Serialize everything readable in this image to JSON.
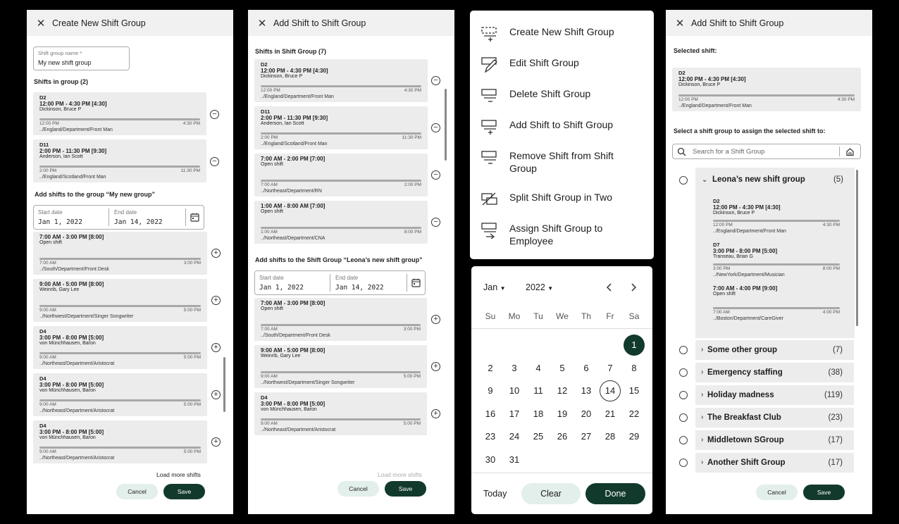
{
  "p1": {
    "title": "Create New Shift Group",
    "name_label": "Shift group name *",
    "name_value": "My new shift group",
    "shifts_heading": "Shifts in group (2)",
    "group_shifts": [
      {
        "tag": "D2",
        "time": "12:00 PM - 4:30 PM [4:30]",
        "name": "Dickinson, Bruce P",
        "start": "12:00 PM",
        "end": "4:30 PM",
        "path": "../England/Department/Front Man"
      },
      {
        "tag": "D11",
        "time": "2:00 PM - 11:30 PM [9:30]",
        "name": "Anderson, Ian Scott",
        "start": "2:00 PM",
        "end": "11:30 PM",
        "path": "../England/Scotland/Front Man"
      }
    ],
    "add_heading": "Add shifts to the group “My new group”",
    "start_label": "Start date",
    "start_value": "Jan 1, 2022",
    "end_label": "End date",
    "end_value": "Jan 14, 2022",
    "available": [
      {
        "tag": "",
        "time": "7:00 AM - 3:00 PM [8:00]",
        "name": "Open shift",
        "start": "7:00 AM",
        "end": "3:00 PM",
        "path": "../South/Department/Front Desk"
      },
      {
        "tag": "",
        "time": "9:00 AM - 5:00 PM [8:00]",
        "name": "Weinrib, Gary Lee",
        "start": "9:00 AM",
        "end": "5:00 PM",
        "path": "../Northwest/Department/Singer Songwriter"
      },
      {
        "tag": "D4",
        "time": "3:00 PM - 8:00 PM [5:00]",
        "name": "von Münchhausen, Baron",
        "start": "9:00 AM",
        "end": "5:00 PM",
        "path": "../Northeast/Department/Aristocrat"
      },
      {
        "tag": "D4",
        "time": "3:00 PM - 8:00 PM [5:00]",
        "name": "von Münchhausen, Baron",
        "start": "9:00 AM",
        "end": "5:00 PM",
        "path": "../Northeast/Department/Aristocrat"
      },
      {
        "tag": "D4",
        "time": "3:00 PM - 8:00 PM [5:00]",
        "name": "von Münchhausen, Baron",
        "start": "9:00 AM",
        "end": "5:00 PM",
        "path": "../Northeast/Department/Aristocrat"
      }
    ],
    "load_more": "Load more shifts",
    "cancel": "Cancel",
    "save": "Save"
  },
  "p2": {
    "title": "Add Shift to Shift Group",
    "shifts_heading": "Shifts in Shift Group (7)",
    "group_shifts": [
      {
        "tag": "D2",
        "time": "12:00 PM - 4:30 PM [4:30]",
        "name": "Dickinson, Bruce P",
        "start": "12:00 PM",
        "end": "4:30 PM",
        "path": "../England/Department/Front Man"
      },
      {
        "tag": "D11",
        "time": "2:00 PM - 11:30 PM [9:30]",
        "name": "Anderson, Ian Scott",
        "start": "2:00 PM",
        "end": "11:30 PM",
        "path": "../England/Scotland/Front Man"
      },
      {
        "tag": "",
        "time": "7:00 AM - 2:00 PM [7:00]",
        "name": "Open shift",
        "start": "7:00 AM",
        "end": "2:00 PM",
        "path": "../Northeast/Department/RN"
      },
      {
        "tag": "",
        "time": "1:00 AM - 8:00 AM [7:00]",
        "name": "Open shift",
        "start": "1:00 AM",
        "end": "8:00 PM",
        "path": "../Northeast/Department/CNA"
      }
    ],
    "add_heading": "Add shifts to the Shift Group “Leona’s new shift group”",
    "start_label": "Start date",
    "start_value": "Jan 1, 2022",
    "end_label": "End date",
    "end_value": "Jan 14, 2022",
    "available": [
      {
        "tag": "",
        "time": "7:00 AM - 3:00 PM [8:00]",
        "name": "Open shift",
        "start": "7:00 AM",
        "end": "3:00 PM",
        "path": "../South/Department/Front Desk"
      },
      {
        "tag": "",
        "time": "9:00 AM - 5:00 PM [8:00]",
        "name": "Weinrib, Gary Lee",
        "start": "9:00 AM",
        "end": "5:00 PM",
        "path": "../Northwest/Department/Singer Songwriter"
      },
      {
        "tag": "D4",
        "time": "3:00 PM - 8:00 PM [5:00]",
        "name": "von Münchhausen, Baron",
        "start": "9:00 AM",
        "end": "5:00 PM",
        "path": "../Northeast/Department/Aristocrat"
      }
    ],
    "load_more": "Load more shifts",
    "cancel": "Cancel",
    "save": "Save"
  },
  "menu": {
    "items": [
      {
        "label": "Create New Shift Group",
        "icon": "create-group-icon"
      },
      {
        "label": "Edit Shift Group",
        "icon": "pencil-icon"
      },
      {
        "label": "Delete Shift Group",
        "icon": "delete-group-icon"
      },
      {
        "label": "Add Shift to Shift Group",
        "icon": "add-shift-icon"
      },
      {
        "label": "Remove Shift from Shift Group",
        "icon": "remove-shift-icon"
      },
      {
        "label": "Split Shift Group in Two",
        "icon": "split-icon"
      },
      {
        "label": "Assign Shift Group to Employee",
        "icon": "assign-icon"
      }
    ]
  },
  "calendar": {
    "month": "Jan",
    "year": "2022",
    "dow": [
      "Su",
      "Mo",
      "Tu",
      "We",
      "Th",
      "Fr",
      "Sa"
    ],
    "weeks": [
      [
        "",
        "",
        "",
        "",
        "",
        "",
        "1"
      ],
      [
        "2",
        "3",
        "4",
        "5",
        "6",
        "7",
        "8"
      ],
      [
        "9",
        "10",
        "11",
        "12",
        "13",
        "14",
        "15"
      ],
      [
        "16",
        "17",
        "18",
        "19",
        "20",
        "21",
        "22"
      ],
      [
        "23",
        "24",
        "25",
        "26",
        "27",
        "28",
        "29"
      ],
      [
        "30",
        "31",
        "",
        "",
        "",
        "",
        ""
      ]
    ],
    "selected": "1",
    "range_end": "14",
    "today": "Today",
    "clear": "Clear",
    "done": "Done"
  },
  "p4": {
    "title": "Add Shift to Shift Group",
    "selected_heading": "Selected shift:",
    "selected_shift": {
      "tag": "D2",
      "time": "12:00 PM - 4:30 PM [4:30]",
      "name": "Dickinson, Bruce P",
      "start": "12:00 PM",
      "end": "4:30 PM",
      "path": "../England/Department/Front Man"
    },
    "select_heading": "Select a shift group to assign the selected shift to:",
    "search_placeholder": "Search for a Shift Group",
    "expanded": {
      "name": "Leona’s new shift group",
      "count": "(5)",
      "shifts": [
        {
          "tag": "D2",
          "time": "12:00 PM - 4:30 PM [4:30]",
          "name": "Dickinson, Bruce P",
          "start": "12:00 PM",
          "end": "4:30 PM",
          "path": "../England/Department/Front Man"
        },
        {
          "tag": "D7",
          "time": "3:00 PM - 8:00 PM [5:00]",
          "name": "Transeau, Brian G",
          "start": "3:00 PM",
          "end": "8:00 PM",
          "path": "../NewYork/Department/Musician"
        },
        {
          "tag": "",
          "time": "7:00 AM - 4:00 PM [9:00]",
          "name": "Open shift",
          "start": "7:00 AM",
          "end": "4:00 PM",
          "path": "../Boston/Department/CareGiver"
        }
      ]
    },
    "groups": [
      {
        "name": "Some other group",
        "count": "(7)"
      },
      {
        "name": "Emergency staffing",
        "count": "(38)"
      },
      {
        "name": "Holiday madness",
        "count": "(119)"
      },
      {
        "name": "The Breakfast Club",
        "count": "(23)"
      },
      {
        "name": "Middletown SGroup",
        "count": "(17)"
      },
      {
        "name": "Another Shift Group",
        "count": "(17)"
      }
    ],
    "cancel": "Cancel",
    "save": "Save"
  }
}
